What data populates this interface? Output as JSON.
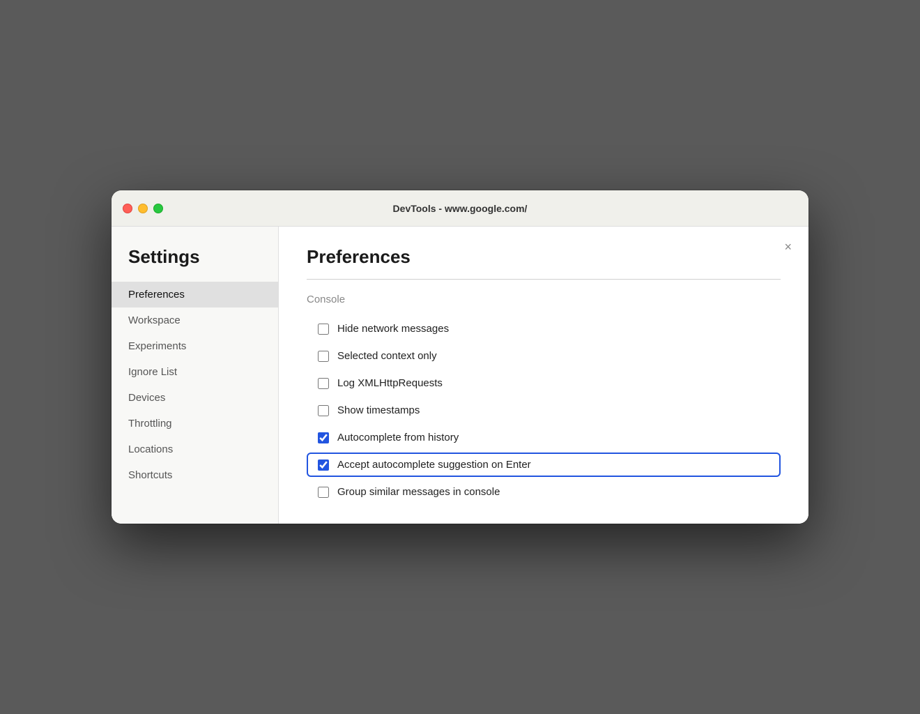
{
  "window": {
    "title": "DevTools - www.google.com/"
  },
  "sidebar": {
    "heading": "Settings",
    "items": [
      {
        "id": "preferences",
        "label": "Preferences",
        "active": true
      },
      {
        "id": "workspace",
        "label": "Workspace",
        "active": false
      },
      {
        "id": "experiments",
        "label": "Experiments",
        "active": false
      },
      {
        "id": "ignore-list",
        "label": "Ignore List",
        "active": false
      },
      {
        "id": "devices",
        "label": "Devices",
        "active": false
      },
      {
        "id": "throttling",
        "label": "Throttling",
        "active": false
      },
      {
        "id": "locations",
        "label": "Locations",
        "active": false
      },
      {
        "id": "shortcuts",
        "label": "Shortcuts",
        "active": false
      }
    ]
  },
  "main": {
    "panel_title": "Preferences",
    "close_label": "×",
    "section_title": "Console",
    "checkboxes": [
      {
        "id": "hide-network",
        "label": "Hide network messages",
        "checked": false,
        "highlighted": false
      },
      {
        "id": "selected-context",
        "label": "Selected context only",
        "checked": false,
        "highlighted": false
      },
      {
        "id": "log-xmlhttp",
        "label": "Log XMLHttpRequests",
        "checked": false,
        "highlighted": false
      },
      {
        "id": "show-timestamps",
        "label": "Show timestamps",
        "checked": false,
        "highlighted": false
      },
      {
        "id": "autocomplete-history",
        "label": "Autocomplete from history",
        "checked": true,
        "highlighted": false
      },
      {
        "id": "autocomplete-enter",
        "label": "Accept autocomplete suggestion on Enter",
        "checked": true,
        "highlighted": true
      },
      {
        "id": "group-similar",
        "label": "Group similar messages in console",
        "checked": false,
        "highlighted": false
      }
    ]
  },
  "traffic_lights": {
    "close_color": "#ff5f57",
    "minimize_color": "#ffbd2e",
    "maximize_color": "#28c840"
  }
}
